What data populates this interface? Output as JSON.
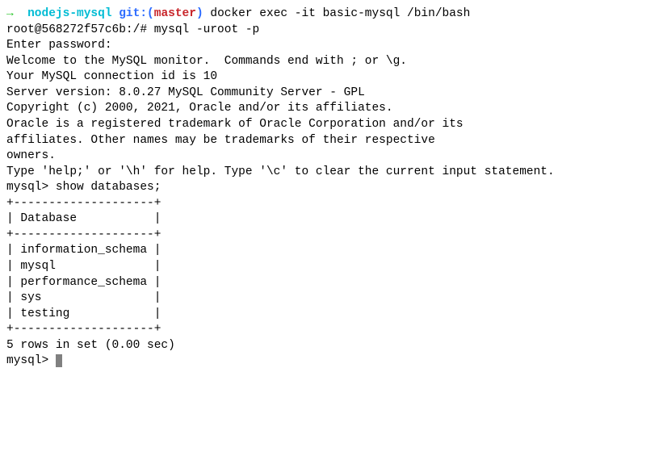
{
  "prompt": {
    "arrow": "→",
    "folder": "nodejs-mysql",
    "git": "git:",
    "paren_open": "(",
    "branch": "master",
    "paren_close": ")",
    "command": "docker exec -it basic-mysql /bin/bash"
  },
  "lines": {
    "l1": "root@568272f57c6b:/# mysql -uroot -p",
    "l2": "Enter password:",
    "l3": "Welcome to the MySQL monitor.  Commands end with ; or \\g.",
    "l4": "Your MySQL connection id is 10",
    "l5": "Server version: 8.0.27 MySQL Community Server - GPL",
    "l6": "",
    "l7": "Copyright (c) 2000, 2021, Oracle and/or its affiliates.",
    "l8": "",
    "l9": "Oracle is a registered trademark of Oracle Corporation and/or its",
    "l10": "affiliates. Other names may be trademarks of their respective",
    "l11": "owners.",
    "l12": "",
    "l13": "Type 'help;' or '\\h' for help. Type '\\c' to clear the current input statement.",
    "l14": "",
    "l15": "mysql> show databases;",
    "t_top": "+--------------------+",
    "t_head": "| Database           |",
    "t_sep": "+--------------------+",
    "t_r1": "| information_schema |",
    "t_r2": "| mysql              |",
    "t_r3": "| performance_schema |",
    "t_r4": "| sys                |",
    "t_r5": "| testing            |",
    "t_bottom": "+--------------------+",
    "l_rows": "5 rows in set (0.00 sec)",
    "l_blank2": "",
    "l_prompt2": "mysql> "
  }
}
